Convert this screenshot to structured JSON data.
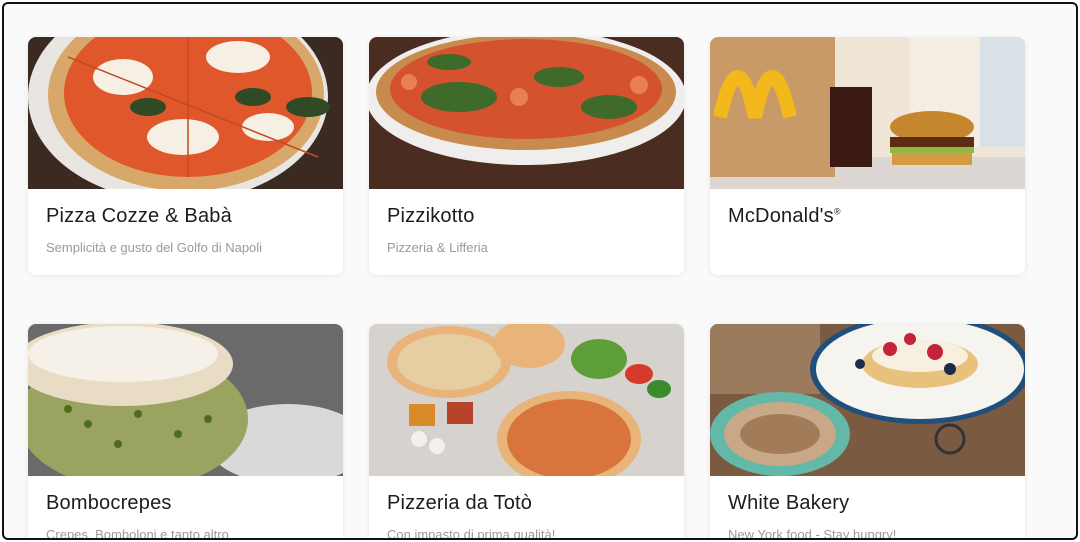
{
  "restaurants": [
    {
      "name": "Pizza Cozze & Babà",
      "mark": "",
      "description": "Semplicità e gusto del Golfo di Napoli",
      "image": "margherita-pizza-photo"
    },
    {
      "name": "Pizzikotto",
      "mark": "",
      "description": "Pizzeria & Lifferia",
      "image": "basil-pizza-photo"
    },
    {
      "name": "McDonald's",
      "mark": "®",
      "description": "",
      "image": "burger-bag-photo"
    },
    {
      "name": "Bombocrepes",
      "mark": "",
      "description": "Crepes, Bomboloni e tanto altro",
      "image": "bombolone-photo"
    },
    {
      "name": "Pizzeria da Totò",
      "mark": "",
      "description": "Con impasto di prima qualità!",
      "image": "pizza-ingredients-photo"
    },
    {
      "name": "White Bakery",
      "mark": "",
      "description": "New York food - Stay hungry!",
      "image": "pancakes-coffee-photo"
    }
  ]
}
